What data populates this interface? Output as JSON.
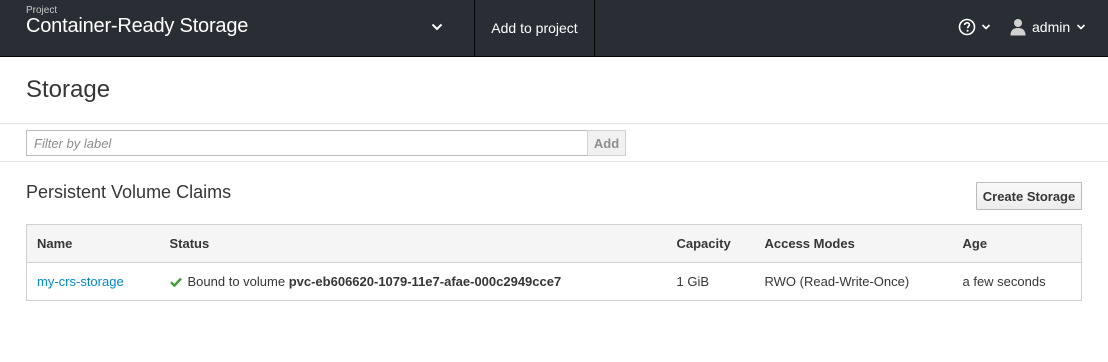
{
  "topbar": {
    "project_caption": "Project",
    "project_name": "Container-Ready Storage",
    "add_to_project": "Add to project",
    "help_icon": "question-circle-icon",
    "user_icon": "user-icon",
    "user_name": "admin"
  },
  "page": {
    "title": "Storage"
  },
  "filter": {
    "placeholder": "Filter by label",
    "value": "",
    "add_label": "Add"
  },
  "section": {
    "title": "Persistent Volume Claims",
    "create_button": "Create Storage"
  },
  "table": {
    "columns": [
      "Name",
      "Status",
      "Capacity",
      "Access Modes",
      "Age"
    ],
    "rows": [
      {
        "name": "my-crs-storage",
        "status_icon": "check-icon",
        "status_text": "Bound to volume",
        "volume": "pvc-eb606620-1079-11e7-afae-000c2949cce7",
        "capacity": "1 GiB",
        "access_modes": "RWO (Read-Write-Once)",
        "age": "a few seconds"
      }
    ]
  },
  "colors": {
    "topbar_bg": "#292e34",
    "link": "#0088ce",
    "success": "#3f9c35"
  }
}
